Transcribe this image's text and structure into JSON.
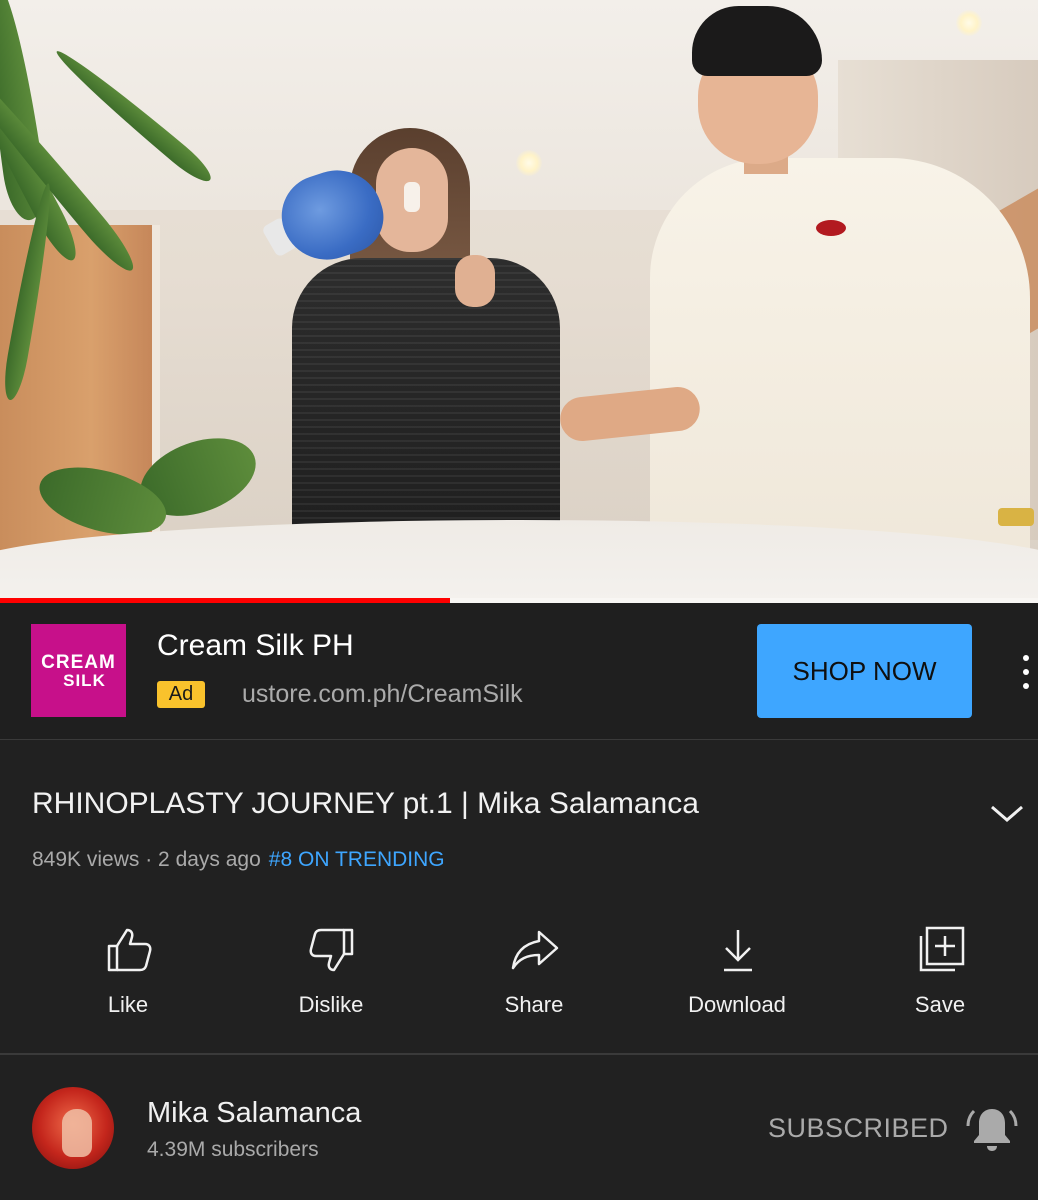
{
  "video": {
    "progress_fraction": 0.434
  },
  "ad": {
    "logo_text_line1": "CREAM",
    "logo_text_line2": "SILK",
    "logo_color": "#c7108a",
    "advertiser": "Cream Silk PH",
    "badge": "Ad",
    "badge_color": "#f9c22c",
    "url": "ustore.com.ph/CreamSilk",
    "cta": "SHOP NOW",
    "cta_color": "#3ea6ff",
    "more_icon": "more-vert-icon"
  },
  "title": {
    "text": "RHINOPLASTY JOURNEY pt.1 | Mika Salamanca",
    "expand_icon": "chevron-down-icon"
  },
  "meta": {
    "views_and_age": "849K views · 2 days ago",
    "trending": "#8 ON TRENDING",
    "trending_color": "#3ea6ff"
  },
  "actions": [
    {
      "label": "Like",
      "icon": "thumbs-up-icon"
    },
    {
      "label": "Dislike",
      "icon": "thumbs-down-icon"
    },
    {
      "label": "Share",
      "icon": "share-icon"
    },
    {
      "label": "Download",
      "icon": "download-icon"
    },
    {
      "label": "Save",
      "icon": "add-to-playlist-icon"
    }
  ],
  "channel": {
    "name": "Mika Salamanca",
    "subscribers": "4.39M subscribers",
    "subscribe_state": "SUBSCRIBED",
    "bell_icon": "notification-bell-icon"
  },
  "colors": {
    "background": "#212121",
    "progress": "#ff0000"
  }
}
